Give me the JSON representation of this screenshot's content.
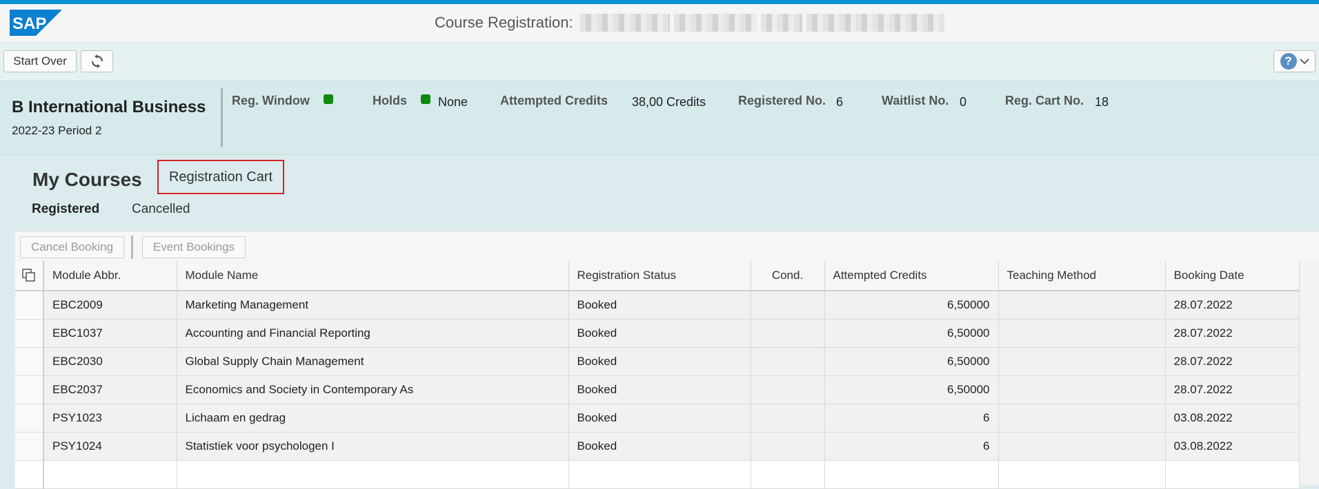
{
  "shell": {
    "logo_text": "SAP",
    "title": "Course Registration:"
  },
  "toolbar": {
    "start_over": "Start Over",
    "refresh_icon": "refresh-icon",
    "help_icon": "help-icon",
    "help_glyph": "?"
  },
  "program": {
    "name": "B International Business",
    "period": "2022-23 Period 2"
  },
  "status": {
    "reg_window_label": "Reg. Window",
    "holds_label": "Holds",
    "holds_value": "None",
    "attempted_label": "Attempted Credits",
    "attempted_value": "38,00 Credits",
    "registered_label": "Registered No.",
    "registered_value": "6",
    "waitlist_label": "Waitlist No.",
    "waitlist_value": "0",
    "cart_label": "Reg. Cart No.",
    "cart_value": "18",
    "indicator_color": "#0d8a0d"
  },
  "courses": {
    "title": "My Courses",
    "cart_button": "Registration Cart",
    "tabs": {
      "registered": "Registered",
      "cancelled": "Cancelled"
    },
    "actions": {
      "cancel_booking": "Cancel Booking",
      "event_bookings": "Event Bookings"
    },
    "columns": {
      "abbr": "Module Abbr.",
      "name": "Module Name",
      "status": "Registration Status",
      "cond": "Cond.",
      "credits": "Attempted Credits",
      "method": "Teaching Method",
      "date": "Booking Date"
    },
    "rows": [
      {
        "abbr": "EBC2009",
        "name": "Marketing Management",
        "status": "Booked",
        "cond": "",
        "credits": "6,50000",
        "method": "",
        "date": "28.07.2022"
      },
      {
        "abbr": "EBC1037",
        "name": "Accounting and Financial Reporting",
        "status": "Booked",
        "cond": "",
        "credits": "6,50000",
        "method": "",
        "date": "28.07.2022"
      },
      {
        "abbr": "EBC2030",
        "name": "Global Supply Chain Management",
        "status": "Booked",
        "cond": "",
        "credits": "6,50000",
        "method": "",
        "date": "28.07.2022"
      },
      {
        "abbr": "EBC2037",
        "name": "Economics and Society in Contemporary As",
        "status": "Booked",
        "cond": "",
        "credits": "6,50000",
        "method": "",
        "date": "28.07.2022"
      },
      {
        "abbr": "PSY1023",
        "name": "Lichaam en gedrag",
        "status": "Booked",
        "cond": "",
        "credits": "6",
        "method": "",
        "date": "03.08.2022"
      },
      {
        "abbr": "PSY1024",
        "name": "Statistiek voor psychologen I",
        "status": "Booked",
        "cond": "",
        "credits": "6",
        "method": "",
        "date": "03.08.2022"
      }
    ]
  }
}
